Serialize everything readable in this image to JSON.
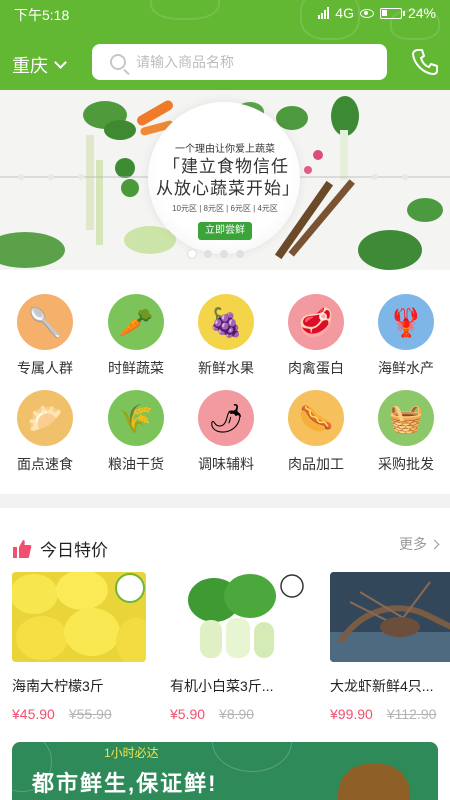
{
  "status_bar": {
    "time": "下午5:18",
    "network": "4G",
    "battery": "24%"
  },
  "header": {
    "city": "重庆",
    "search_placeholder": "请输入商品名称"
  },
  "banner": {
    "tagline": "一个理由让你爱上蔬菜",
    "title_line1": "「建立食物信任",
    "title_line2": "从放心蔬菜开始」",
    "price_zones": "10元区 | 8元区 | 6元区 | 4元区",
    "button": "立即尝鲜",
    "total_slides": 4,
    "active_slide": 1
  },
  "categories": [
    {
      "label": "专属人群",
      "icon": "chef-utensils-icon",
      "bg": "#f5b06b"
    },
    {
      "label": "时鲜蔬菜",
      "icon": "vegetables-icon",
      "bg": "#7cc45a"
    },
    {
      "label": "新鲜水果",
      "icon": "fruits-icon",
      "bg": "#f4d54a"
    },
    {
      "label": "肉禽蛋白",
      "icon": "meat-egg-icon",
      "bg": "#f29aa0"
    },
    {
      "label": "海鲜水产",
      "icon": "seafood-icon",
      "bg": "#7fb6e8"
    },
    {
      "label": "面点速食",
      "icon": "dumpling-icon",
      "bg": "#f0c06a"
    },
    {
      "label": "粮油干货",
      "icon": "grain-oil-icon",
      "bg": "#7cc45a"
    },
    {
      "label": "调味辅料",
      "icon": "spice-icon",
      "bg": "#f29aa0"
    },
    {
      "label": "肉品加工",
      "icon": "sausage-icon",
      "bg": "#f6c15c"
    },
    {
      "label": "采购批发",
      "icon": "basket-icon",
      "bg": "#8cc86a"
    }
  ],
  "deals": {
    "title": "今日特价",
    "more": "更多",
    "items": [
      {
        "name": "海南大柠檬3斤",
        "price": "¥45.90",
        "old_price": "¥55.90"
      },
      {
        "name": "有机小白菜3斤...",
        "price": "¥5.90",
        "old_price": "¥8.90"
      },
      {
        "name": "大龙虾新鲜4只...",
        "price": "¥99.90",
        "old_price": "¥112.90"
      }
    ]
  },
  "promo": {
    "small": "1小时必达",
    "big": "都市鲜生,保证鲜!"
  },
  "colors": {
    "brand_green": "#62b832",
    "price_red": "#f0506e"
  }
}
